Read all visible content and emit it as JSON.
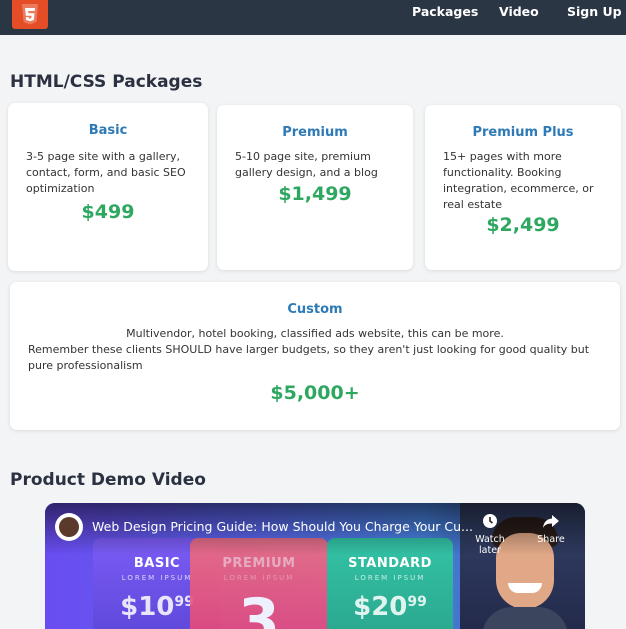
{
  "nav": {
    "logo_icon": "html5-icon",
    "links": [
      "Packages",
      "Video",
      "Sign Up"
    ]
  },
  "packages": {
    "title": "HTML/CSS Packages",
    "cards": [
      {
        "name": "Basic",
        "desc": "3-5 page site with a gallery, contact, form, and basic SEO optimization",
        "price": "$499"
      },
      {
        "name": "Premium",
        "desc": "5-10 page site, premium gallery design, and a blog",
        "price": "$1,499"
      },
      {
        "name": "Premium Plus",
        "desc": "15+ pages with more functionality. Booking integration, ecommerce, or real estate",
        "price": "$2,499"
      },
      {
        "name": "Custom",
        "desc_line1": "Multivendor, hotel booking, classified ads website, this can be more.",
        "desc_line2": "Remember these clients SHOULD have larger budgets, so they aren't just looking for good quality but pure professionalism",
        "price": "$5,000+"
      }
    ]
  },
  "video_section": {
    "title": "Product Demo Video",
    "video_title": "Web Design Pricing Guide: How Should You Charge Your Cu...",
    "watch_later": "Watch later",
    "share": "Share",
    "panels": [
      {
        "name": "BASIC",
        "sub": "LOREM IPSUM",
        "price": "$10",
        "cents": "99"
      },
      {
        "name": "PREMIUM",
        "sub": "LOREM IPSUM",
        "price": "3",
        "cents": ""
      },
      {
        "name": "STANDARD",
        "sub": "LOREM IPSUM",
        "price": "$20",
        "cents": "99"
      }
    ]
  },
  "colors": {
    "nav_bg": "#2b3645",
    "card_title": "#2e7ab6",
    "price": "#2ea860",
    "html5_orange": "#e44d26"
  }
}
